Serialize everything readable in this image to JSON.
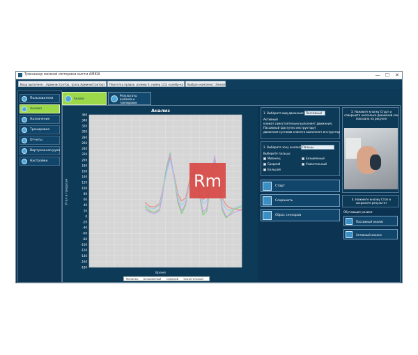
{
  "window": {
    "title": "Тренажер мелкой моторики кисти AMIRA",
    "minimize": "—",
    "maximize": "☐",
    "close": "✕"
  },
  "infobar": {
    "user": "Вход выполнен: _Администратор_ (роль Администратор)",
    "device": "Перчатка правая, размер S, номер 123, калибр-ка 8",
    "complex": "Выбран комплекс: Эпилоги"
  },
  "sidebar": {
    "items": [
      {
        "label": "Пользователи",
        "icon": "users-icon"
      },
      {
        "label": "Анализ",
        "icon": "analysis-icon"
      },
      {
        "label": "Назначение",
        "icon": "assignment-icon"
      },
      {
        "label": "Тренировка",
        "icon": "training-icon"
      },
      {
        "label": "Отчеты",
        "icon": "reports-icon"
      },
      {
        "label": "Виртуальная рука",
        "icon": "virtual-hand-icon"
      },
      {
        "label": "Настройки",
        "icon": "settings-icon"
      }
    ]
  },
  "tabs": [
    {
      "label": "Анализ"
    },
    {
      "label": "Результаты анализа и тренировки"
    }
  ],
  "watermark": "Rm",
  "controls": {
    "step1_label": "1. Выберите вид движения:",
    "step1_value": "Пассивный",
    "mode_title": "Активный",
    "mode_desc1": "климат самостоятельно выполняет движения;",
    "mode_desc2": "Пассивный (доступно инструктору)",
    "mode_desc3": "движения суставов клиента выполняет инструктор",
    "step2_label": "2. Выберите зону анализа:",
    "step2_value": "Пальцы",
    "fingers_label": "Выберите пальцы:",
    "fingers": [
      "Мизинец",
      "Безымянный",
      "Средний",
      "Указательный",
      "Большой"
    ],
    "start": "Старт",
    "save": "Сохранить",
    "reset": "Сброс сенсоров"
  },
  "right": {
    "step3": "3. Нажмите кнопку Старт и совершите несколько движений как показано на рисунке",
    "step4": "4. Нажмите кнопку Стоп и сохраните результат",
    "learning": "Обучающие ролики",
    "passive_btn": "Пассивный анализ",
    "active_btn": "Активный анализ"
  },
  "chart_data": {
    "type": "line",
    "title": "Анализ",
    "xlabel": "Время",
    "ylabel": "Угол в градусах",
    "ylim": [
      -180,
      360
    ],
    "yticks": [
      360,
      340,
      320,
      300,
      280,
      260,
      240,
      220,
      200,
      180,
      160,
      140,
      120,
      100,
      80,
      60,
      40,
      20,
      0,
      -20,
      -40,
      -60,
      -80,
      -100,
      -120,
      -140,
      -160,
      -180
    ],
    "grid": true,
    "legend_position": "bottom",
    "series": [
      {
        "name": "Мизинец",
        "color": "#f08a7a",
        "x": [
          0,
          5,
          10,
          15,
          18,
          22,
          26,
          30,
          34,
          38,
          42,
          47,
          52,
          56,
          60,
          64,
          68,
          72,
          76,
          80,
          84,
          88,
          92,
          96,
          100
        ],
        "y": [
          50,
          35,
          34,
          45,
          90,
          160,
          210,
          150,
          80,
          55,
          65,
          140,
          170,
          110,
          60,
          70,
          150,
          200,
          130,
          65,
          40,
          30,
          28,
          25,
          25
        ]
      },
      {
        "name": "Безымянный",
        "color": "#7fd07a",
        "x": [
          0,
          5,
          10,
          15,
          18,
          22,
          26,
          30,
          34,
          38,
          42,
          47,
          52,
          56,
          60,
          64,
          68,
          72,
          76,
          80,
          84,
          88,
          92,
          96,
          100
        ],
        "y": [
          35,
          20,
          15,
          25,
          80,
          170,
          225,
          140,
          50,
          10,
          40,
          135,
          160,
          80,
          5,
          20,
          120,
          210,
          120,
          20,
          -5,
          10,
          25,
          30,
          35
        ]
      },
      {
        "name": "Средний",
        "color": "#c9a3e8",
        "x": [
          0,
          5,
          10,
          15,
          18,
          22,
          26,
          30,
          34,
          38,
          42,
          47,
          52,
          56,
          60,
          64,
          68,
          72,
          76,
          80,
          84,
          88,
          92,
          96,
          100
        ],
        "y": [
          25,
          15,
          10,
          20,
          70,
          160,
          220,
          145,
          60,
          20,
          45,
          130,
          165,
          90,
          15,
          30,
          130,
          215,
          125,
          30,
          0,
          5,
          15,
          20,
          22
        ]
      },
      {
        "name": "Указательный",
        "color": "#9fcfe8",
        "x": [
          0,
          5,
          10,
          15,
          18,
          22,
          26,
          30,
          34,
          38,
          42,
          47,
          52,
          56,
          60,
          64,
          68,
          72,
          76,
          80,
          84,
          88,
          92,
          96,
          100
        ],
        "y": [
          40,
          30,
          28,
          40,
          85,
          150,
          200,
          140,
          70,
          40,
          55,
          125,
          155,
          100,
          45,
          55,
          140,
          190,
          120,
          50,
          25,
          20,
          30,
          35,
          38
        ]
      }
    ]
  }
}
